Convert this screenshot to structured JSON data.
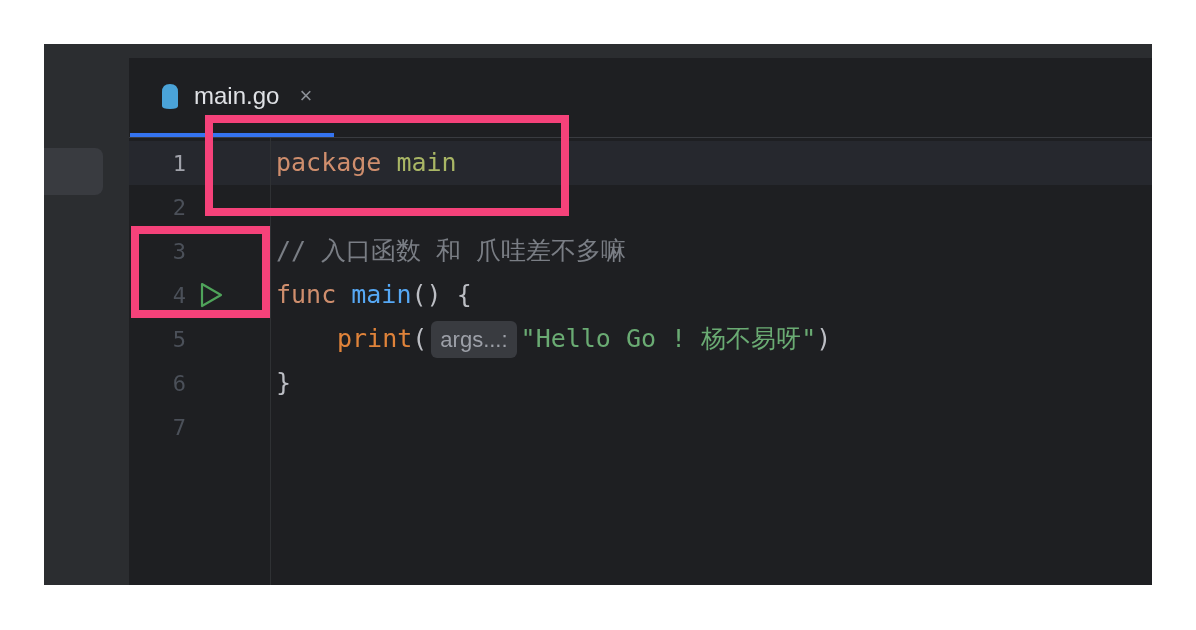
{
  "sidebar": {
    "items": [
      {
        "selected": true
      }
    ]
  },
  "tabs": [
    {
      "label": "main.go",
      "close": "×",
      "selected": true
    }
  ],
  "editor": {
    "lines": [
      {
        "number": "1",
        "current": true,
        "run": false,
        "tokens": [
          {
            "kind": "keyword",
            "text": "package"
          },
          {
            "kind": "package",
            "text": " main"
          }
        ]
      },
      {
        "number": "2",
        "current": false,
        "run": false
      },
      {
        "number": "3",
        "current": false,
        "run": false,
        "tokens": [
          {
            "kind": "comment",
            "text": "// 入口函数 和 爪哇差不多嘛"
          }
        ]
      },
      {
        "number": "4",
        "current": false,
        "run": true,
        "tokens": [
          {
            "kind": "keyword",
            "text": "func"
          },
          {
            "kind": "function",
            "text": " main"
          },
          {
            "kind": "plain",
            "text": "() {"
          }
        ]
      },
      {
        "number": "5",
        "current": false,
        "run": false,
        "indented": true,
        "tokens": [
          {
            "kind": "builtin",
            "text": "print"
          },
          {
            "kind": "plain",
            "text": "("
          },
          {
            "kind": "hint",
            "text": "args...:"
          },
          {
            "kind": "string",
            "text": "\"Hello Go ! 杨不易呀\""
          },
          {
            "kind": "plain",
            "text": ")"
          }
        ]
      },
      {
        "number": "6",
        "current": false,
        "run": false,
        "tokens": [
          {
            "kind": "plain",
            "text": "}"
          }
        ]
      },
      {
        "number": "7",
        "current": false,
        "run": false
      }
    ]
  }
}
